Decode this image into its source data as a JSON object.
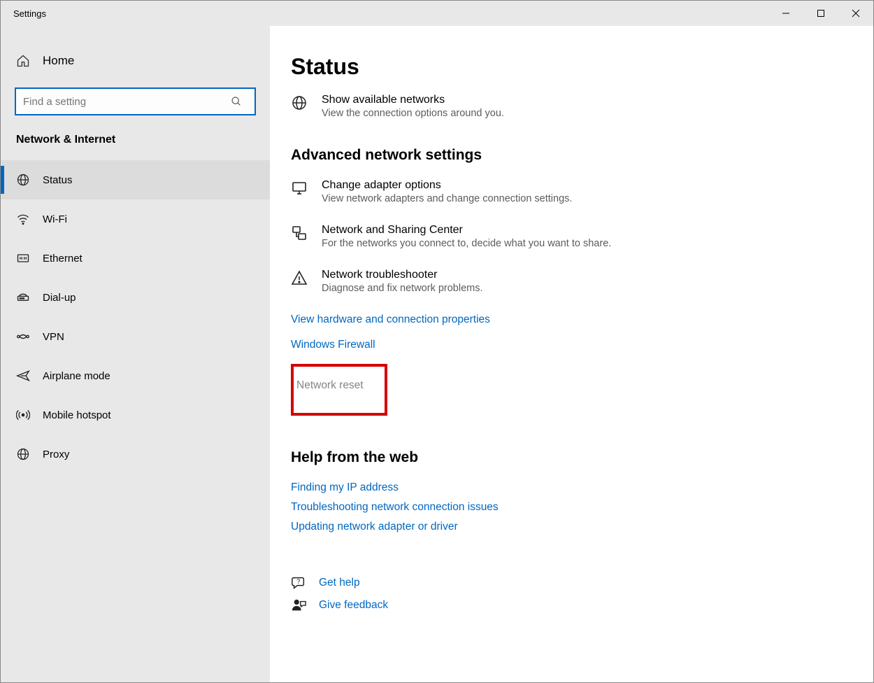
{
  "window": {
    "title": "Settings"
  },
  "sidebar": {
    "home": "Home",
    "search_placeholder": "Find a setting",
    "category": "Network & Internet",
    "items": [
      {
        "label": "Status"
      },
      {
        "label": "Wi-Fi"
      },
      {
        "label": "Ethernet"
      },
      {
        "label": "Dial-up"
      },
      {
        "label": "VPN"
      },
      {
        "label": "Airplane mode"
      },
      {
        "label": "Mobile hotspot"
      },
      {
        "label": "Proxy"
      }
    ]
  },
  "main": {
    "title": "Status",
    "show_networks": {
      "title": "Show available networks",
      "desc": "View the connection options around you."
    },
    "section_advanced": "Advanced network settings",
    "adapter": {
      "title": "Change adapter options",
      "desc": "View network adapters and change connection settings."
    },
    "sharing": {
      "title": "Network and Sharing Center",
      "desc": "For the networks you connect to, decide what you want to share."
    },
    "troubleshoot": {
      "title": "Network troubleshooter",
      "desc": "Diagnose and fix network problems."
    },
    "link_hardware": "View hardware and connection properties",
    "link_firewall": "Windows Firewall",
    "link_reset": "Network reset",
    "section_help": "Help from the web",
    "help_ip": "Finding my IP address",
    "help_trouble": "Troubleshooting network connection issues",
    "help_driver": "Updating network adapter or driver",
    "get_help": "Get help",
    "give_feedback": "Give feedback"
  }
}
